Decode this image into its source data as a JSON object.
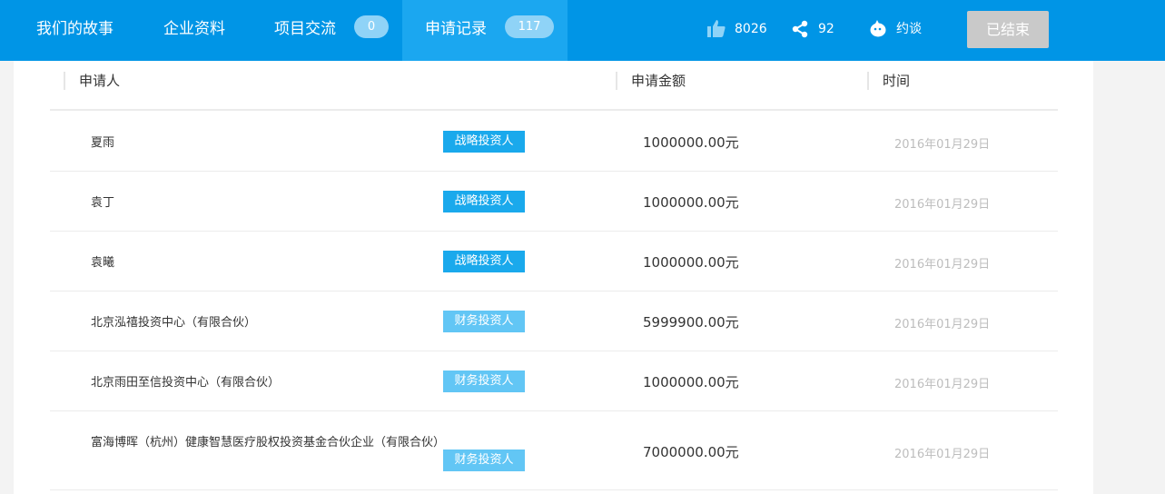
{
  "nav": {
    "tabs": [
      {
        "label": "我们的故事"
      },
      {
        "label": "企业资料"
      },
      {
        "label": "项目交流",
        "count": "0"
      },
      {
        "label": "申请记录",
        "count": "117"
      }
    ],
    "likes": "8026",
    "shares": "92",
    "chat_label": "约谈",
    "ended_label": "已结束",
    "colors": {
      "bar": "#0095e6",
      "active_tab": "#1ba7f0",
      "pill": "#8fd3f7"
    }
  },
  "table": {
    "headers": {
      "applicant": "申请人",
      "amount": "申请金额",
      "time": "时间"
    },
    "rows": [
      {
        "name": "夏雨",
        "type": "战略投资人",
        "type_kind": "strategic",
        "amount": "1000000.00元",
        "date": "2016年01月29日"
      },
      {
        "name": "袁丁",
        "type": "战略投资人",
        "type_kind": "strategic",
        "amount": "1000000.00元",
        "date": "2016年01月29日"
      },
      {
        "name": "袁曦",
        "type": "战略投资人",
        "type_kind": "strategic",
        "amount": "1000000.00元",
        "date": "2016年01月29日"
      },
      {
        "name": "北京泓禧投资中心（有限合伙）",
        "type": "财务投资人",
        "type_kind": "financial",
        "amount": "5999900.00元",
        "date": "2016年01月29日"
      },
      {
        "name": "北京雨田至信投资中心（有限合伙）",
        "type": "财务投资人",
        "type_kind": "financial",
        "amount": "1000000.00元",
        "date": "2016年01月29日"
      },
      {
        "name": "富海博晖（杭州）健康智慧医疗股权投资基金合伙企业（有限合伙）",
        "type": "财务投资人",
        "type_kind": "financial",
        "amount": "7000000.00元",
        "date": "2016年01月29日"
      }
    ]
  }
}
